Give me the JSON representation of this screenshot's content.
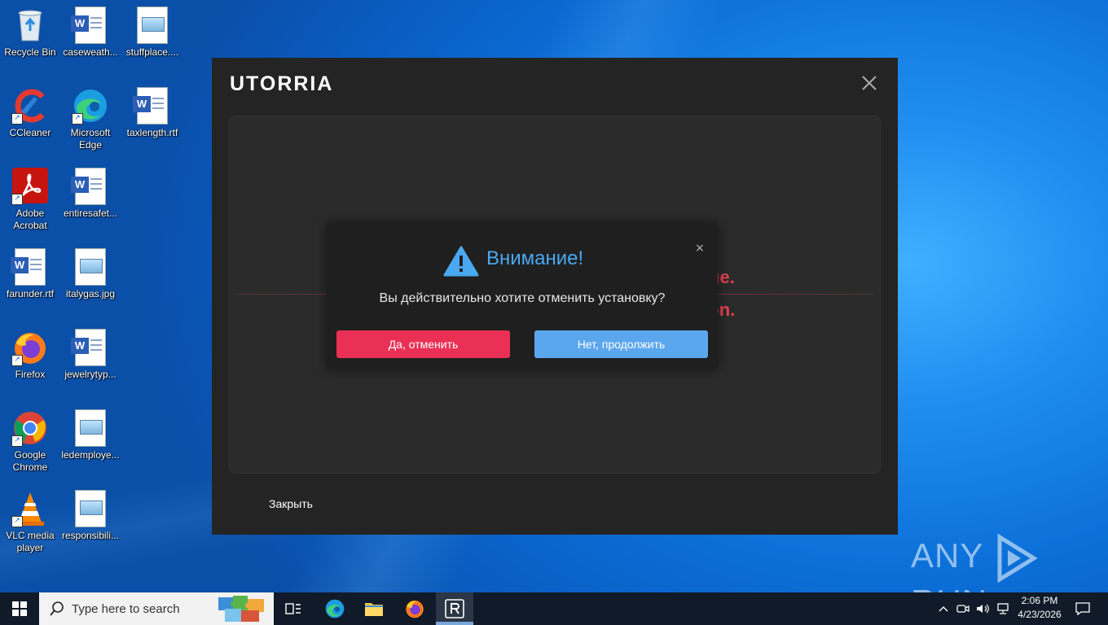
{
  "desktop": {
    "icons": [
      {
        "label": "Recycle Bin"
      },
      {
        "label": "caseweath..."
      },
      {
        "label": "stuffplace...."
      },
      {
        "label": "CCleaner"
      },
      {
        "label": "Microsoft Edge"
      },
      {
        "label": "taxlength.rtf"
      },
      {
        "label": "Adobe Acrobat"
      },
      {
        "label": "entiresafet..."
      },
      {
        "label": "farunder.rtf"
      },
      {
        "label": "italygas.jpg"
      },
      {
        "label": "Firefox"
      },
      {
        "label": "jewelrytyp..."
      },
      {
        "label": "Google Chrome"
      },
      {
        "label": "ledemploye..."
      },
      {
        "label": "VLC media player"
      },
      {
        "label": "responsibili..."
      }
    ]
  },
  "app": {
    "logo": "UTORRIA",
    "error_ru": "Установка недоступна в вашем регионе.",
    "error_en": "Application is not available in your region.",
    "close_link": "Закрыть"
  },
  "modal": {
    "title": "Внимание!",
    "question": "Вы действительно хотите отменить установку?",
    "yes_label": "Да, отменить",
    "no_label": "Нет, продолжить",
    "close_glyph": "×"
  },
  "watermark": {
    "left": "ANY",
    "right": "RUN"
  },
  "taskbar": {
    "search_placeholder": "Type here to search",
    "time": "2:06 PM",
    "date": "4/23/2026"
  },
  "colors": {
    "accent_red": "#e7424e",
    "yes_button": "#ea3055",
    "no_button": "#5ba7ee",
    "title_blue": "#4aa8f0"
  }
}
